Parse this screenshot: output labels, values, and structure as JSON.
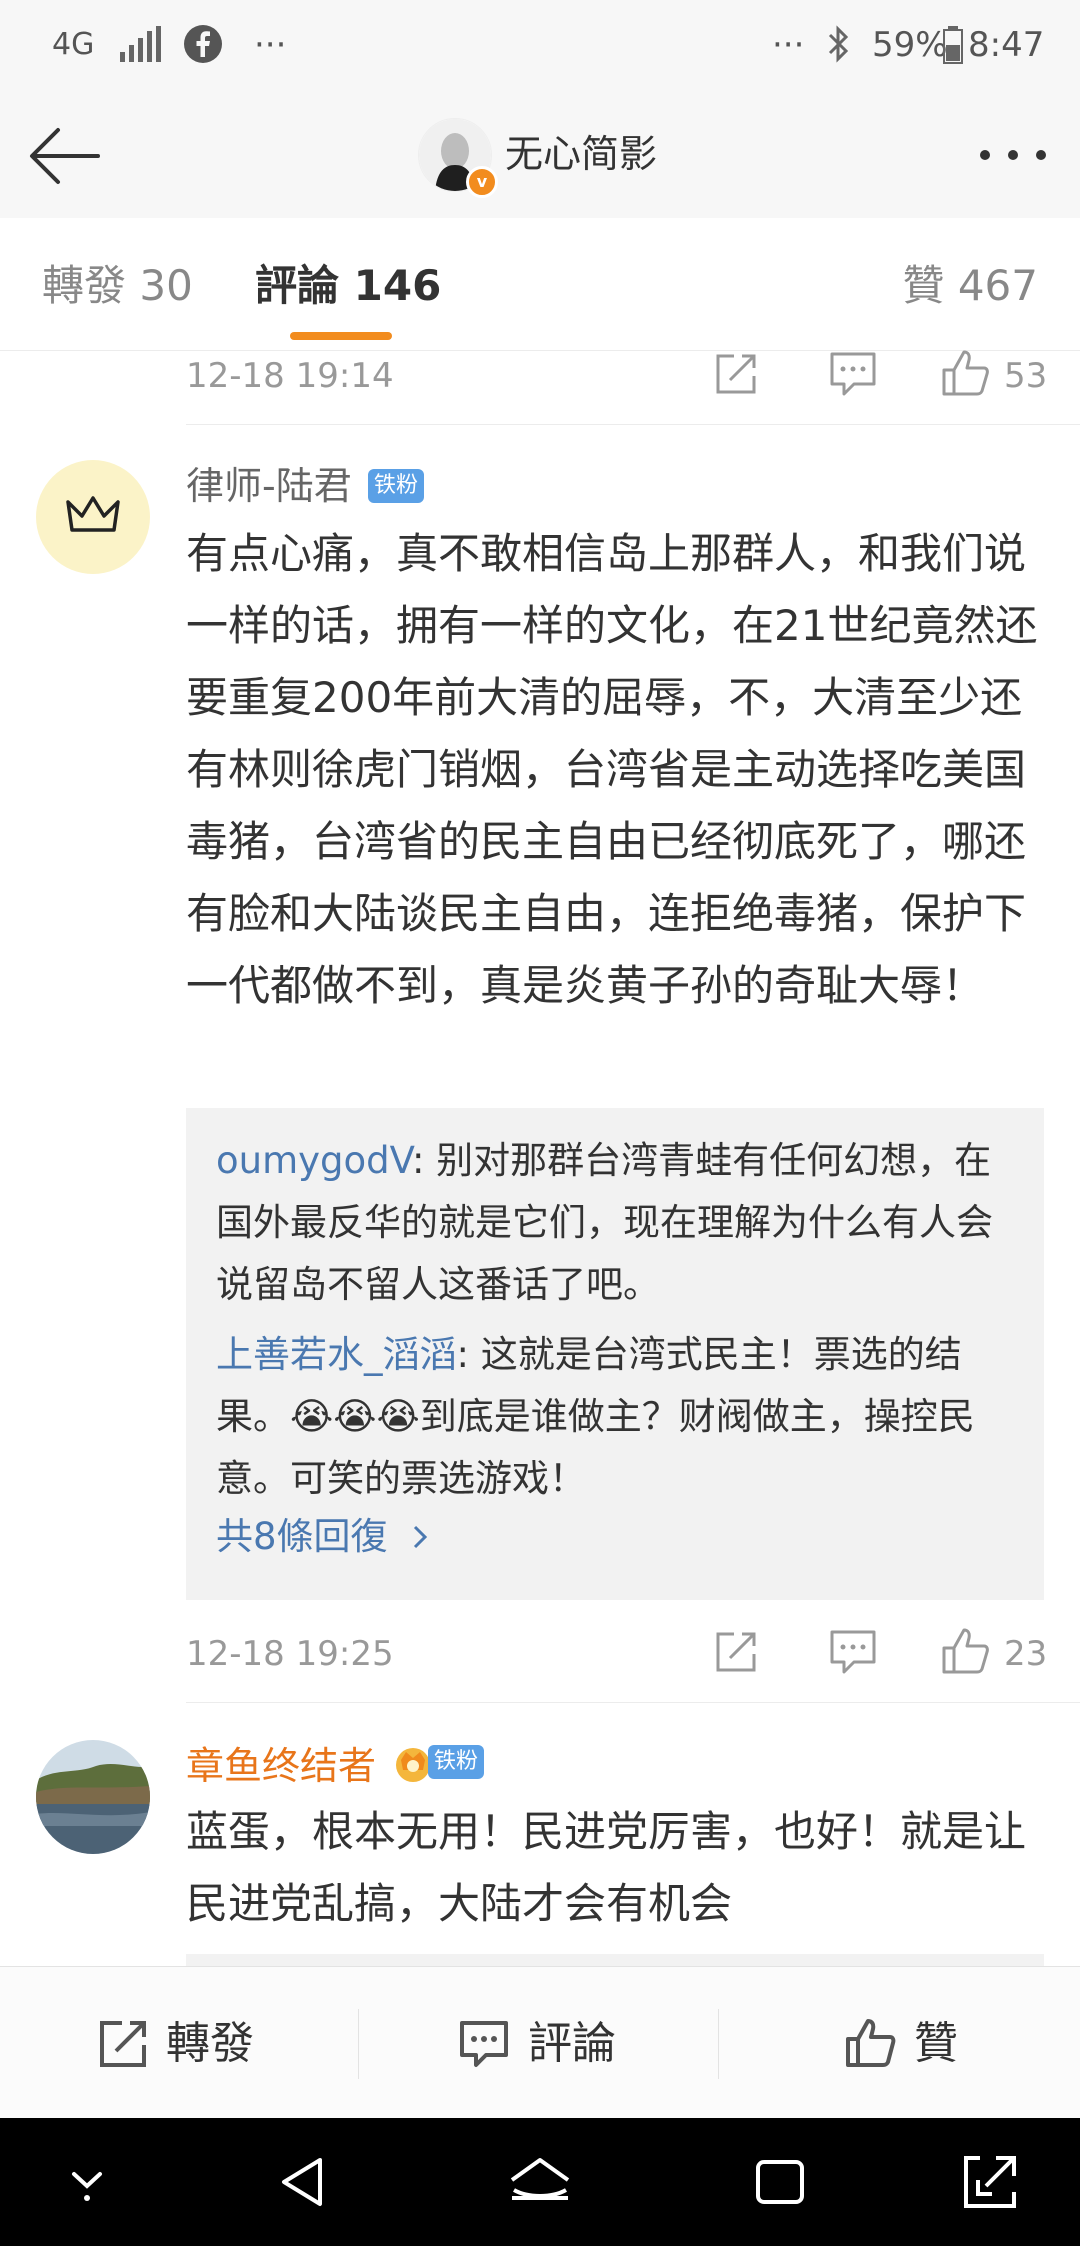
{
  "status_bar": {
    "network": "4G",
    "signal_icon": "signal-icon",
    "facebook_icon": "facebook-icon",
    "left_more": "···",
    "right_more": "···",
    "bluetooth_icon": "bluetooth-icon",
    "battery_percent": "59%",
    "time": "8:47"
  },
  "header": {
    "title": "无心简影",
    "verified_mark": "v"
  },
  "tabs": {
    "repost": "轉發 30",
    "comments": "評論 146",
    "likes": "贊 467"
  },
  "comments": [
    {
      "timestamp": "12-18 19:14",
      "likes": "53"
    },
    {
      "username": "律师-陆君",
      "badge": "铁粉",
      "text": "有点心痛，真不敢相信岛上那群人，和我们说一样的话，拥有一样的文化，在21世纪竟然还要重复200年前大清的屈辱，不，大清至少还有林则徐虎门销烟，台湾省是主动选择吃美国毒猪，台湾省的民主自由已经彻底死了，哪还有脸和大陆谈民主自由，连拒绝毒猪，保护下一代都做不到，真是炎黄子孙的奇耻大辱！",
      "replies": [
        {
          "user": "oumygodV",
          "text": ": 别对那群台湾青蛙有任何幻想，在国外最反华的就是它们，现在理解为什么有人会说留岛不留人这番话了吧。"
        },
        {
          "user": "上善若水_滔滔",
          "text_a": ": 这就是台湾式民主！票选的结果。",
          "emoji": "😭😭😭",
          "text_b": "到底是谁做主？财阀做主，操控民意。可笑的票选游戏！"
        }
      ],
      "more_replies": "共8條回復",
      "timestamp": "12-18 19:25",
      "likes": "23"
    },
    {
      "username": "章鱼终结者",
      "badge": "铁粉",
      "text": "蓝蛋，根本无用！民进党厉害，也好！就是让民进党乱搞，大陆才会有机会"
    }
  ],
  "action_bar": {
    "repost": "轉發",
    "comment": "評論",
    "like": "贊"
  },
  "colors": {
    "accent": "#f28c1e",
    "link": "#4a78b0",
    "username_orange": "#e8751a",
    "badge_blue": "#5aa0e6"
  }
}
